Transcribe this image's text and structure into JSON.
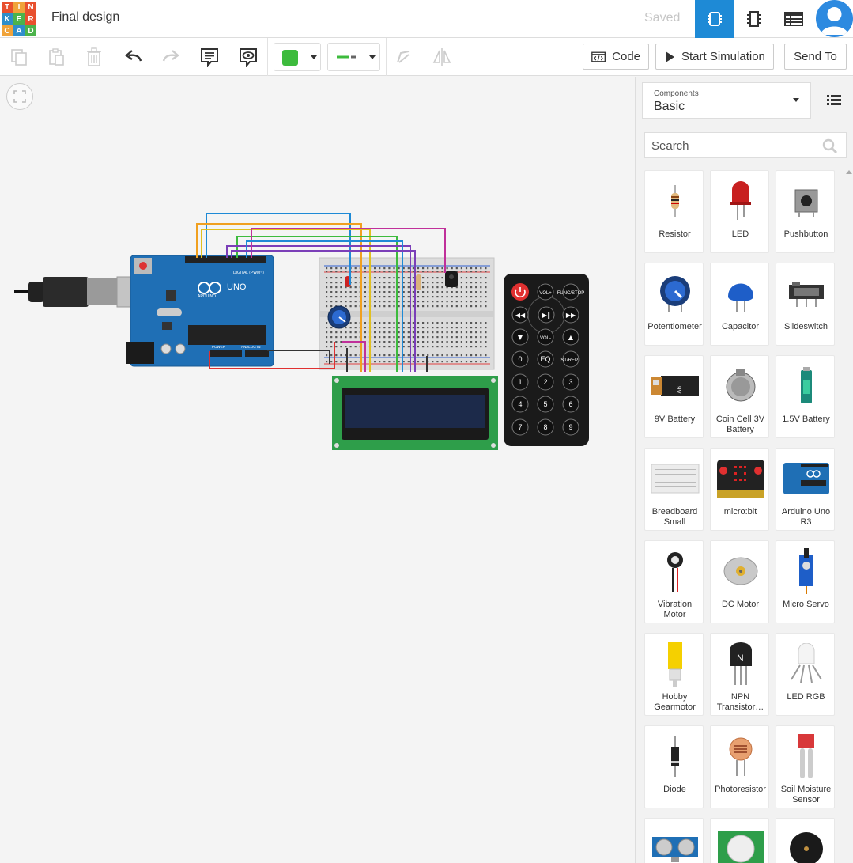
{
  "header": {
    "logo_letters": [
      "T",
      "I",
      "N",
      "K",
      "E",
      "R",
      "C",
      "A",
      "D"
    ],
    "logo_colors": [
      "#e8502e",
      "#f0a33a",
      "#e8502e",
      "#2e8ecb",
      "#4bb34b",
      "#e8502e",
      "#f0a33a",
      "#2e8ecb",
      "#4bb34b"
    ],
    "title": "Final design",
    "save_status": "Saved",
    "views": [
      {
        "name": "circuit-view",
        "icon": "chip-icon",
        "active": true
      },
      {
        "name": "schematic-view",
        "icon": "schematic-icon",
        "active": false
      },
      {
        "name": "component-list-view",
        "icon": "table-icon",
        "active": false
      }
    ],
    "accent": "#1e8ad6"
  },
  "toolbar": {
    "tools": [
      "copy-icon",
      "paste-icon",
      "delete-icon",
      "undo-icon",
      "redo-icon",
      "notes-icon",
      "toggle-notes-icon"
    ],
    "color_swatch": "#3dbb3d",
    "wire_color": "#3dbb3d",
    "code_label": "Code",
    "simulate_label": "Start Simulation",
    "send_label": "Send To"
  },
  "panel": {
    "components_label": "Components",
    "components_value": "Basic",
    "search_placeholder": "Search",
    "components": [
      {
        "name": "Resistor"
      },
      {
        "name": "LED"
      },
      {
        "name": "Pushbutton"
      },
      {
        "name": "Potentiometer"
      },
      {
        "name": "Capacitor"
      },
      {
        "name": "Slideswitch"
      },
      {
        "name": "9V Battery"
      },
      {
        "name": "Coin Cell 3V Battery"
      },
      {
        "name": "1.5V Battery"
      },
      {
        "name": "Breadboard Small"
      },
      {
        "name": "micro:bit"
      },
      {
        "name": "Arduino Uno R3"
      },
      {
        "name": "Vibration Motor"
      },
      {
        "name": "DC Motor"
      },
      {
        "name": "Micro Servo"
      },
      {
        "name": "Hobby Gearmotor"
      },
      {
        "name": "NPN Transistor…"
      },
      {
        "name": "LED RGB"
      },
      {
        "name": "Diode"
      },
      {
        "name": "Photoresistor"
      },
      {
        "name": "Soil Moisture Sensor"
      },
      {
        "name": ""
      },
      {
        "name": ""
      },
      {
        "name": ""
      }
    ]
  },
  "circuit": {
    "board_label": "UNO",
    "board_brand": "ARDUINO",
    "digital_label": "DIGITAL (PWM~)",
    "power_label": "POWER",
    "analog_label": "ANALOG IN",
    "remote_buttons": [
      "VOL+",
      "FUNC/STOP",
      "VOL-",
      "EQ",
      "ST/REPT",
      "0",
      "1",
      "2",
      "3",
      "4",
      "5",
      "6",
      "7",
      "8",
      "9"
    ]
  }
}
